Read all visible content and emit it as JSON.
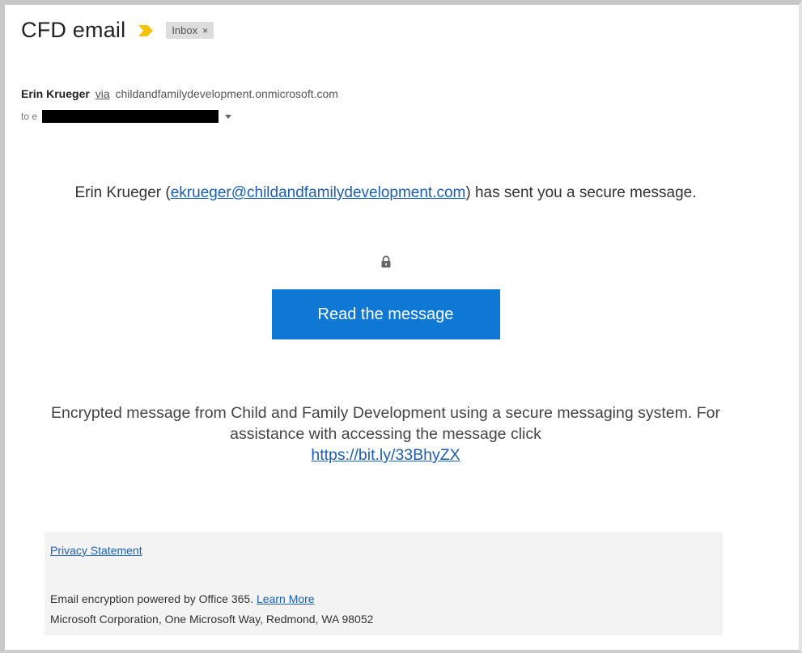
{
  "email": {
    "subject": "CFD email",
    "label": "Inbox",
    "label_remove": "×",
    "sender_name": "Erin Krueger",
    "via_text": "via",
    "sender_domain": "childandfamilydevelopment.onmicrosoft.com",
    "to_label": "to e"
  },
  "message": {
    "sender_display": "Erin Krueger (",
    "sender_email": "ekrueger@childandfamilydevelopment.com",
    "secure_suffix": ") has sent you a secure message.",
    "read_button": "Read the message",
    "encrypted_text": "Encrypted message from Child and Family Development using a secure messaging system. For assistance with accessing the message click",
    "assist_link": "https://bit.ly/33BhyZX"
  },
  "footer": {
    "privacy": "Privacy Statement",
    "encryption_text": "Email encryption powered by Office 365.",
    "learn_more": "Learn More",
    "address": "Microsoft Corporation, One Microsoft Way, Redmond, WA 98052"
  },
  "colors": {
    "accent_button": "#0f78d4",
    "link": "#1a5fb4",
    "importance_marker": "#f4c20d"
  },
  "icons": {
    "importance": "importance-marker-icon",
    "lock": "lock-icon",
    "remove_label": "close-icon",
    "expand_recipients": "chevron-down-icon"
  }
}
